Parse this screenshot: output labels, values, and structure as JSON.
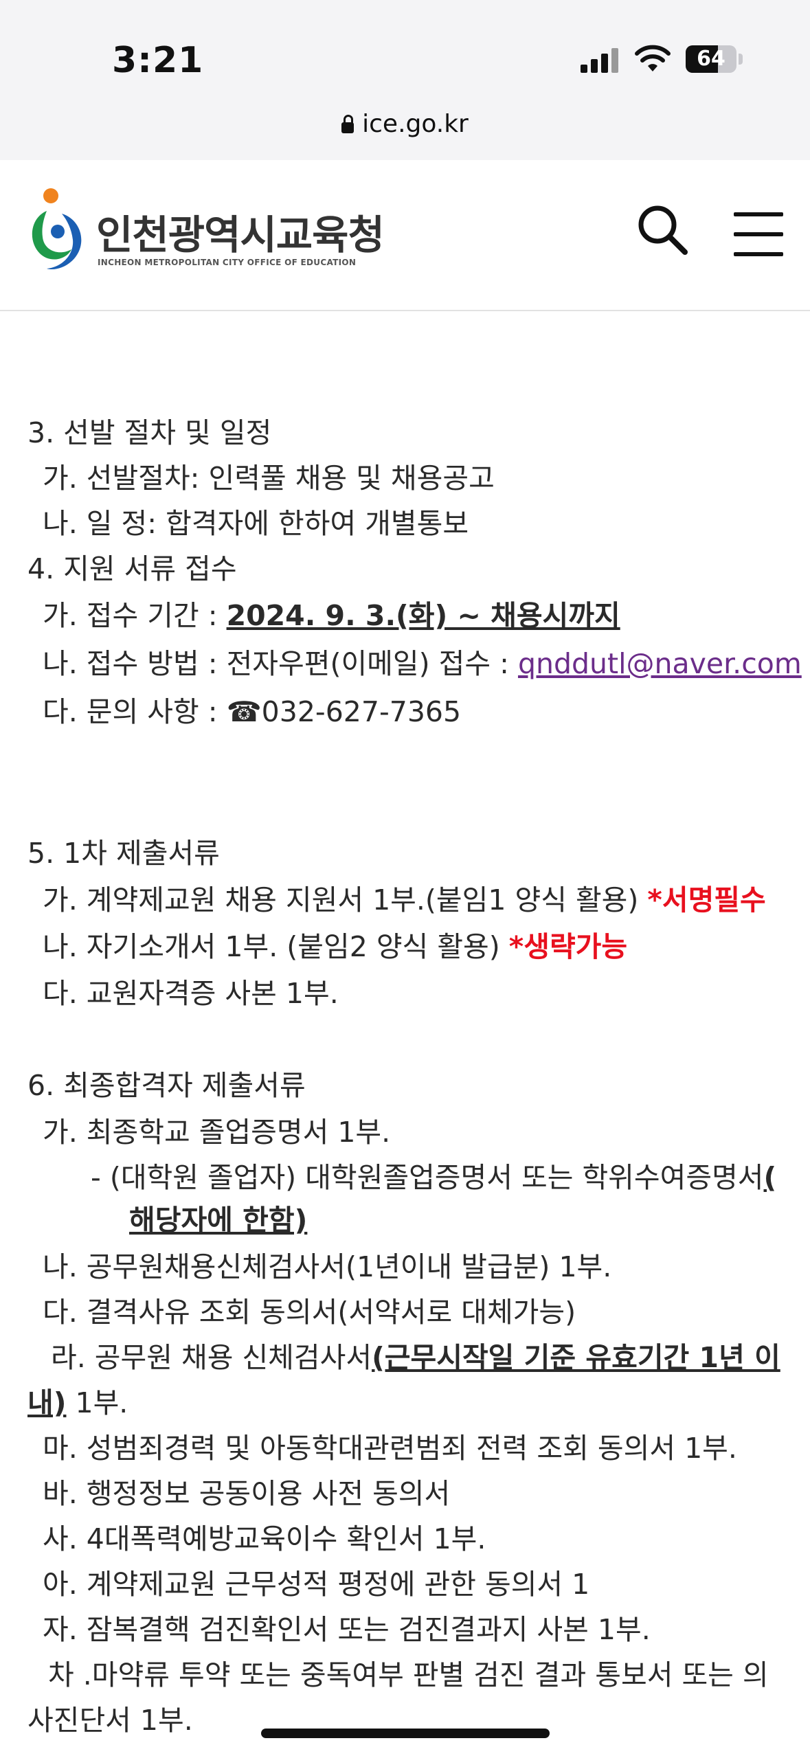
{
  "status": {
    "time": "3:21",
    "battery": "64",
    "battery_level": 0.64
  },
  "browser": {
    "url": "ice.go.kr"
  },
  "site": {
    "name": "인천광역시교육청",
    "name_en": "INCHEON METROPOLITAN CITY OFFICE OF EDUCATION"
  },
  "content": {
    "s3_title": "3. 선발 절차 및 일정",
    "s3_a": "가. 선발절차: 인력풀 채용 및 채용공고",
    "s3_b": "나. 일 정: 합격자에 한하여 개별통보",
    "s4_title": "4. 지원 서류 접수",
    "s4_a_label": "가. 접수 기간 : ",
    "s4_a_value": "2024. 9. 3.(화) ~ 채용시까지",
    "s4_b_label": "나. 접수 방법 : 전자우편(이메일) 접수 : ",
    "s4_b_email": "qnddutl@naver.com",
    "s4_c": "다. 문의 사항 : ☎032-627-7365",
    "s5_title": "5. 1차 제출서류",
    "s5_a": "가. 계약제교원 채용 지원서 1부.(붙임1 양식 활용) ",
    "s5_a_note": "*서명필수",
    "s5_b": "나. 자기소개서 1부. (붙임2 양식 활용) ",
    "s5_b_note": "*생략가능",
    "s5_c": "다. 교원자격증 사본 1부.",
    "s6_title": "6. 최종합격자 제출서류",
    "s6_a": "가. 최종학교 졸업증명서 1부.",
    "s6_a_sub": "- (대학원 졸업자) 대학원졸업증명서 또는 학위수여증명서",
    "s6_a_sub_b1": "(",
    "s6_a_sub_b2": "해당자에 한함)",
    "s6_b": "나. 공무원채용신체검사서(1년이내 발급분) 1부.",
    "s6_c": "다. 결격사유 조회 동의서(서약서로 대체가능)",
    "s6_d": "라. 공무원 채용 신체검사서",
    "s6_d_b1": "(근무시작일 기준 유효기간 1년 이",
    "s6_d_b2": "내)",
    "s6_d_tail": " 1부.",
    "s6_e": "마. 성범죄경력 및 아동학대관련범죄 전력 조회 동의서 1부.",
    "s6_f": "바. 행정정보 공동이용 사전 동의서",
    "s6_g": "사. 4대폭력예방교육이수 확인서 1부.",
    "s6_h": "아. 계약제교원 근무성적 평정에 관한 동의서 1",
    "s6_i": "자. 잠복결핵 검진확인서 또는 검진결과지 사본 1부.",
    "s6_j1": "차 .마약류 투약 또는 중독여부 판별 검진 결과 통보서 또는 의",
    "s6_j2": "사진단서 1부."
  }
}
